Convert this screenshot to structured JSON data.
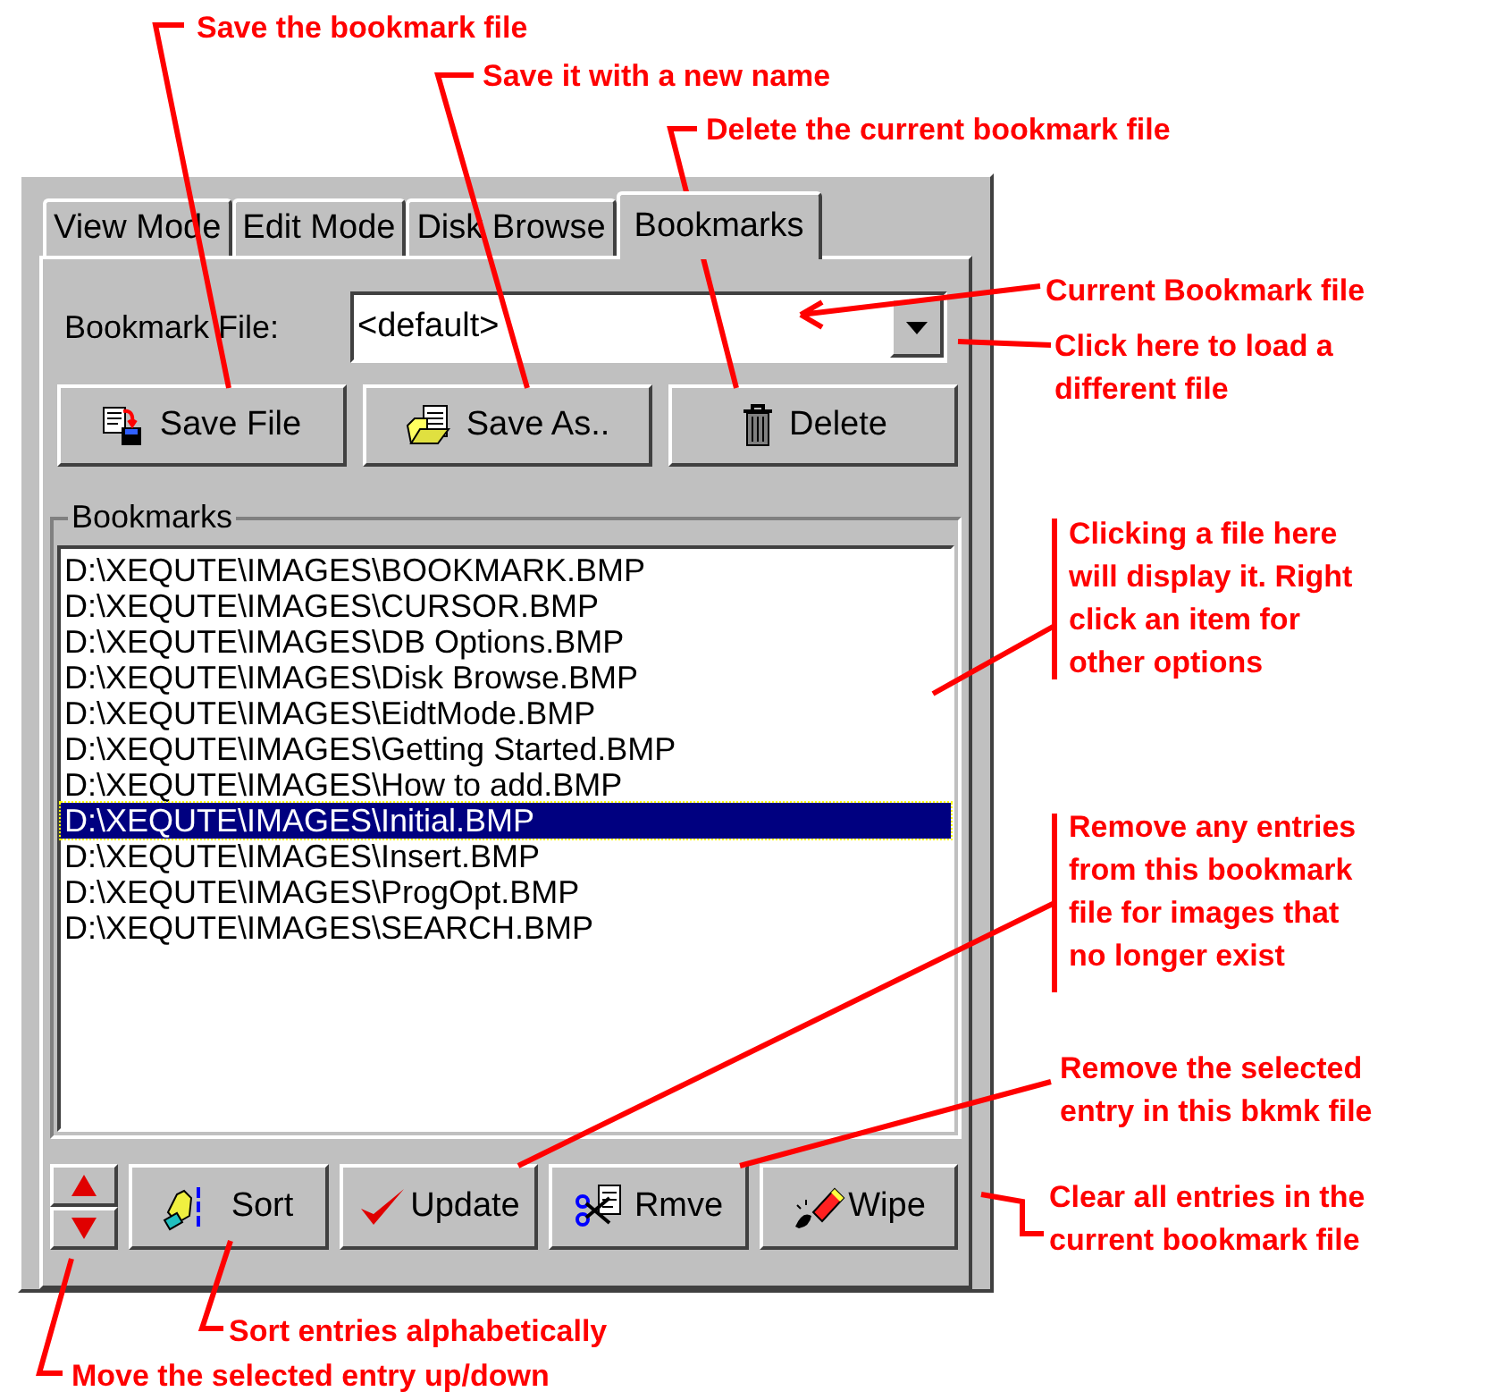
{
  "tabs": [
    {
      "label": "View Mode",
      "selected": false
    },
    {
      "label": "Edit Mode",
      "selected": false
    },
    {
      "label": "Disk Browse",
      "selected": false
    },
    {
      "label": "Bookmarks",
      "selected": true
    }
  ],
  "bookmark_file": {
    "label": "Bookmark File:",
    "value": "<default>"
  },
  "file_buttons": [
    {
      "kind": "save",
      "label": "Save File"
    },
    {
      "kind": "saveas",
      "label": "Save As.."
    },
    {
      "kind": "delete",
      "label": "Delete"
    }
  ],
  "bookmarks": {
    "title": "Bookmarks",
    "items": [
      {
        "label": "D:\\XEQUTE\\IMAGES\\BOOKMARK.BMP",
        "selected": false
      },
      {
        "label": "D:\\XEQUTE\\IMAGES\\CURSOR.BMP",
        "selected": false
      },
      {
        "label": "D:\\XEQUTE\\IMAGES\\DB Options.BMP",
        "selected": false
      },
      {
        "label": "D:\\XEQUTE\\IMAGES\\Disk Browse.BMP",
        "selected": false
      },
      {
        "label": "D:\\XEQUTE\\IMAGES\\EidtMode.BMP",
        "selected": false
      },
      {
        "label": "D:\\XEQUTE\\IMAGES\\Getting Started.BMP",
        "selected": false
      },
      {
        "label": "D:\\XEQUTE\\IMAGES\\How to add.BMP",
        "selected": false
      },
      {
        "label": "D:\\XEQUTE\\IMAGES\\Initial.BMP",
        "selected": true
      },
      {
        "label": "D:\\XEQUTE\\IMAGES\\Insert.BMP",
        "selected": false
      },
      {
        "label": "D:\\XEQUTE\\IMAGES\\ProgOpt.BMP",
        "selected": false
      },
      {
        "label": "D:\\XEQUTE\\IMAGES\\SEARCH.BMP",
        "selected": false
      }
    ]
  },
  "list_buttons": [
    {
      "kind": "sort",
      "label": "Sort"
    },
    {
      "kind": "update",
      "label": "Update"
    },
    {
      "kind": "remove",
      "label": "Rmve"
    },
    {
      "kind": "wipe",
      "label": "Wipe"
    }
  ],
  "annotations": [
    {
      "lines": [
        "Save the bookmark file"
      ]
    },
    {
      "lines": [
        "Save it with a new name"
      ]
    },
    {
      "lines": [
        "Delete the current bookmark file"
      ]
    },
    {
      "lines": [
        "Current Bookmark file"
      ]
    },
    {
      "lines": [
        "Click here to load a",
        "different file"
      ]
    },
    {
      "lines": [
        "Clicking a file here",
        "will display it.  Right",
        "click an item for",
        "other options"
      ]
    },
    {
      "lines": [
        "Remove any entries",
        "from this bookmark",
        "file for images that",
        "no longer exist"
      ]
    },
    {
      "lines": [
        "Remove the selected",
        "entry in this bkmk file"
      ]
    },
    {
      "lines": [
        "Clear all entries in the",
        "current bookmark file"
      ]
    },
    {
      "lines": [
        "Sort entries alphabetically"
      ]
    },
    {
      "lines": [
        "Move the selected entry up/down"
      ]
    }
  ]
}
